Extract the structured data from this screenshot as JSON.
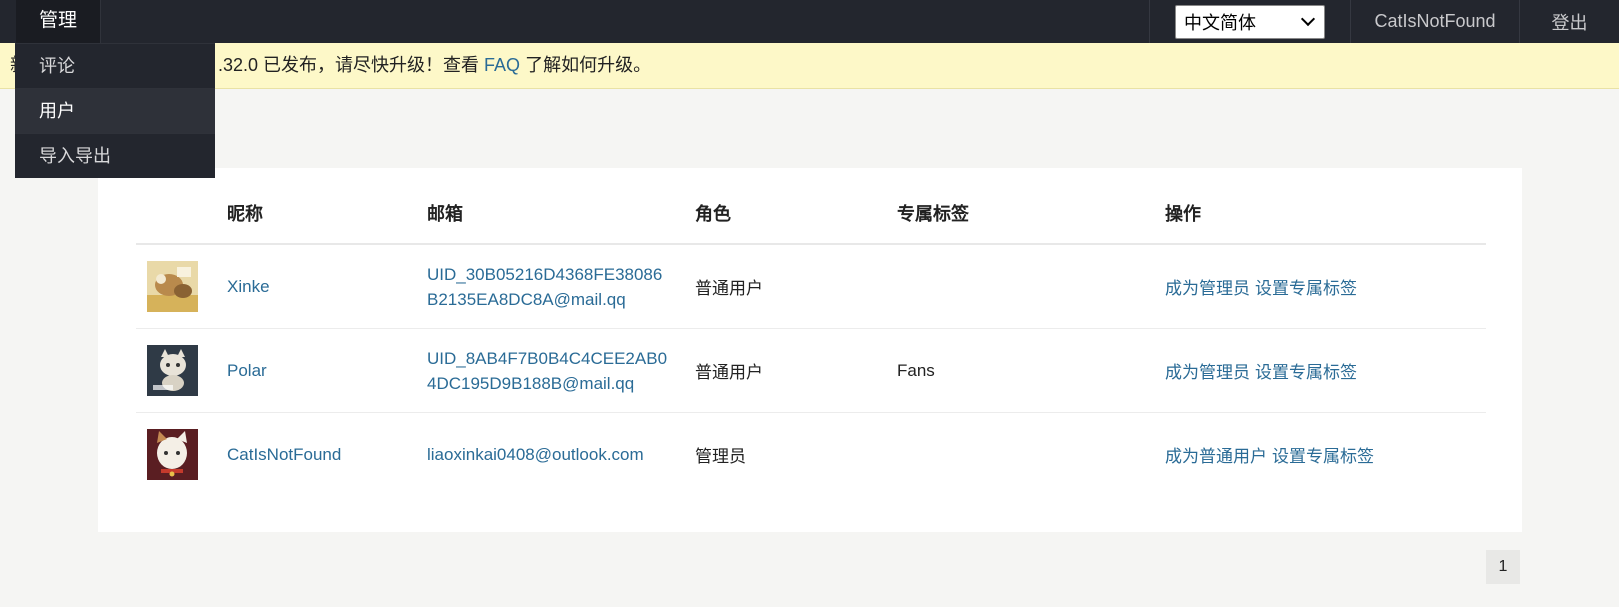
{
  "nav": {
    "manage": "管理",
    "language": "中文简体",
    "username": "CatIsNotFound",
    "logout": "登出"
  },
  "dropdown": {
    "items": [
      "评论",
      "用户",
      "导入导出"
    ]
  },
  "notice": {
    "lead": "新",
    "text_before": ".32.0 已发布，请尽快升级！查看 ",
    "link": "FAQ",
    "text_after": " 了解如何升级。"
  },
  "table": {
    "headers": [
      "昵称",
      "邮箱",
      "角色",
      "专属标签",
      "操作"
    ],
    "rows": [
      {
        "name": "Xinke",
        "email": "UID_30B05216D4368FE38086B2135EA8DC8A@mail.qq",
        "role": "普通用户",
        "label": "",
        "op1": "成为管理员",
        "op2": "设置专属标签"
      },
      {
        "name": "Polar",
        "email": "UID_8AB4F7B0B4C4CEE2AB04DC195D9B188B@mail.qq",
        "role": "普通用户",
        "label": "Fans",
        "op1": "成为管理员",
        "op2": "设置专属标签"
      },
      {
        "name": "CatIsNotFound",
        "email": "liaoxinkai0408@outlook.com",
        "role": "管理员",
        "label": "",
        "op1": "成为普通用户",
        "op2": "设置专属标签"
      }
    ]
  },
  "pagination": {
    "current": "1"
  },
  "colors": {
    "navbar": "#23262e",
    "notice_bg": "#fdf8c8",
    "link": "#2a6b96",
    "page_bg": "#f5f5f3"
  }
}
